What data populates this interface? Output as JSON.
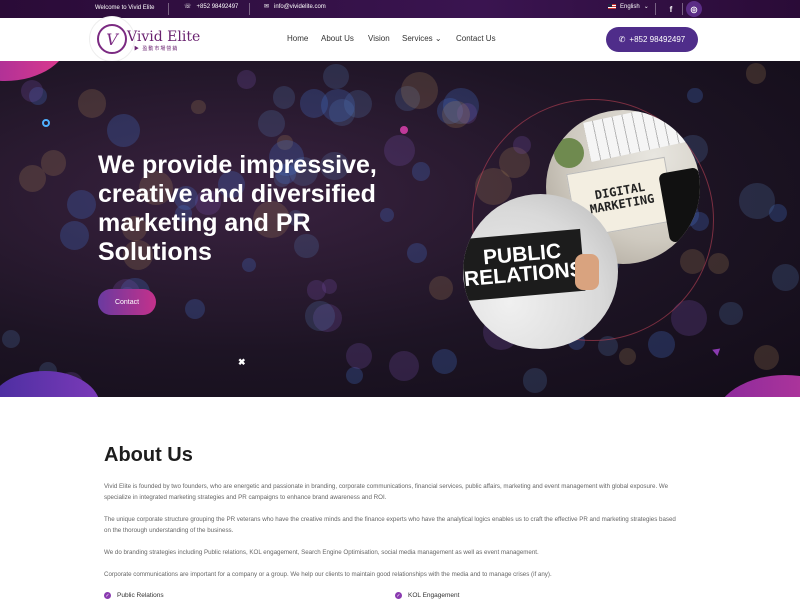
{
  "topbar": {
    "welcome": "Welcome to Vivid Elite",
    "phone": "+852 98492497",
    "email": "info@vividelite.com",
    "language": "English",
    "phone_icon": "phone-icon",
    "email_icon": "envelope-icon",
    "facebook_icon": "f",
    "instagram_icon": "◎"
  },
  "header": {
    "logo_mark": "V",
    "logo_text": "Vivid Elite",
    "logo_sub": "▶ 盈動市場營銷",
    "nav": [
      "Home",
      "About Us",
      "Vision",
      "Services ⌄",
      "Contact Us"
    ],
    "cta_label": "+852 98492497",
    "cta_icon": "whatsapp-icon"
  },
  "hero": {
    "title": "We provide impressive, creative and diversified marketing and PR Solutions",
    "button_label": "Contact",
    "image1_text": "DIGITAL MARKETING",
    "image2_text": "PUBLIC RELATIONS",
    "close_mark": "✖"
  },
  "about": {
    "heading": "About Us",
    "paragraphs": [
      "Vivid Elite is founded by two founders, who are energetic and passionate in branding, corporate communications, financial services, public affairs, marketing and event management with global exposure. We specialize in integrated marketing strategies and PR campaigns to enhance brand awareness and ROI.",
      "The unique corporate structure grouping the PR veterans who have the creative minds and the finance experts who have the analytical logics enables us to craft the effective PR and marketing strategies based on the thorough understanding of the business.",
      "We do branding strategies including Public relations, KOL engagement, Search Engine Optimisation, social media management as well as event management.",
      "Corporate communications are important for a company or a group. We help our clients to maintain good relationships with the media and to manage crises (if any)."
    ],
    "features": [
      "Public Relations",
      "KOL Engagement"
    ]
  },
  "colors": {
    "brand_purple": "#4f2d8a",
    "accent_magenta": "#c4318b"
  }
}
